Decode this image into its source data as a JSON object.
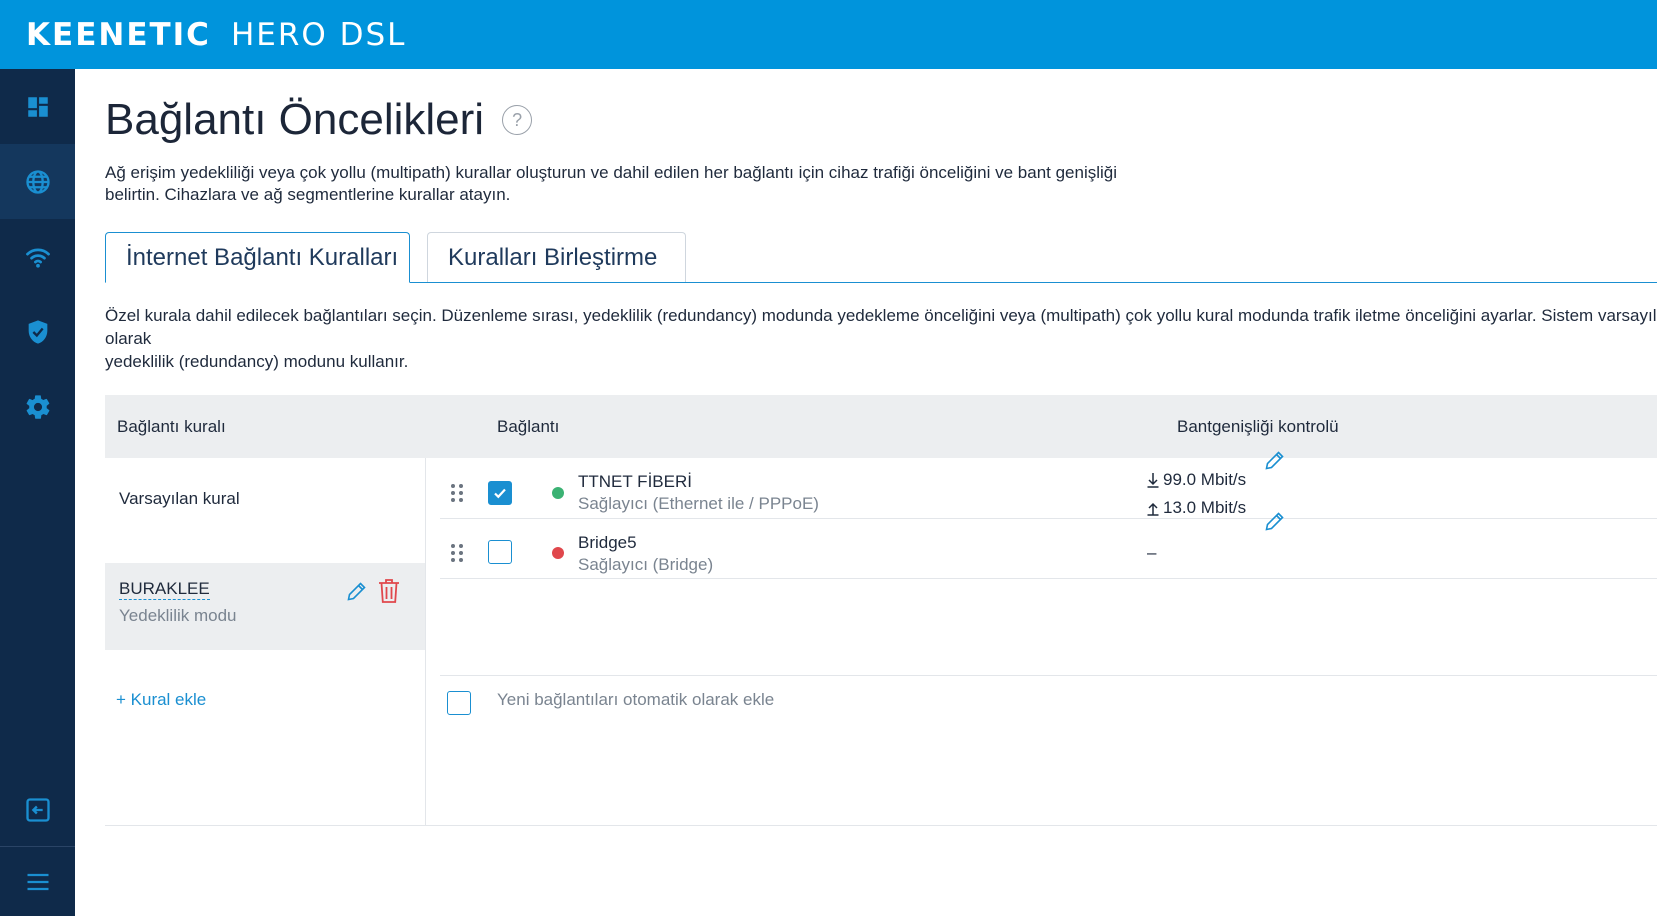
{
  "header": {
    "brand": "KEENETIC",
    "model": "HERO DSL"
  },
  "sidebar": {
    "items": [
      {
        "name": "dashboard",
        "icon": "dashboard-icon"
      },
      {
        "name": "internet",
        "icon": "globe-icon",
        "active": true
      },
      {
        "name": "wifi",
        "icon": "wifi-icon"
      },
      {
        "name": "security",
        "icon": "shield-icon"
      },
      {
        "name": "settings",
        "icon": "gear-icon"
      },
      {
        "name": "logout",
        "icon": "logout-icon"
      },
      {
        "name": "menu",
        "icon": "hamburger-icon"
      }
    ]
  },
  "page": {
    "title": "Bağlantı Öncelikleri",
    "help": "?",
    "description_line1": "Ağ erişim yedekliliği veya çok yollu (multipath) kurallar oluşturun ve dahil edilen her bağlantı için cihaz trafiği önceliğini ve bant genişliği",
    "description_line2": "belirtin. Cihazlara ve ağ segmentlerine kurallar atayın."
  },
  "tabs": [
    {
      "label": "İnternet Bağlantı Kuralları",
      "active": true
    },
    {
      "label": "Kuralları Birleştirme",
      "active": false
    }
  ],
  "tab_description_line1": "Özel kurala dahil edilecek bağlantıları seçin. Düzenleme sırası, yedeklilik (redundancy) modunda yedekleme önceliğini veya (multipath) çok yollu kural modunda trafik iletme önceliğini ayarlar. Sistem varsayılan olarak",
  "tab_description_line2": "yedeklilik (redundancy) modunu kullanır.",
  "table": {
    "headers": {
      "rule": "Bağlantı kuralı",
      "connection": "Bağlantı",
      "bandwidth": "Bantgenişliği kontrolü"
    },
    "rules": [
      {
        "name": "Varsayılan kural",
        "mode": ""
      },
      {
        "name": "BURAKLEE",
        "mode": "Yedeklilik modu",
        "selected": true
      }
    ],
    "connections": [
      {
        "name": "TTNET FİBERİ",
        "sub": "Sağlayıcı (Ethernet ile / PPPoE)",
        "checked": true,
        "status_color": "#3bb273",
        "down": "99.0 Mbit/s",
        "up": "13.0 Mbit/s"
      },
      {
        "name": "Bridge5",
        "sub": "Sağlayıcı (Bridge)",
        "checked": false,
        "status_color": "#e0474c",
        "bw": "–"
      }
    ],
    "add_rule": "+ Kural ekle",
    "auto_add": "Yeni bağlantıları otomatik olarak ekle"
  },
  "colors": {
    "topbar": "#0094dc",
    "sidebar": "#0f2a4a",
    "accent": "#1a8fd1",
    "delete": "#e0474c"
  }
}
